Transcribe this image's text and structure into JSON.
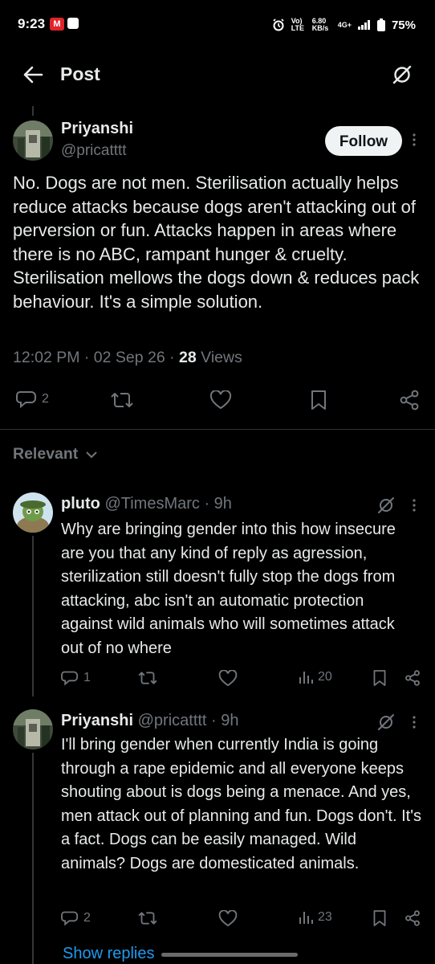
{
  "status_bar": {
    "time": "9:23",
    "badge": "M",
    "net_label": "Vo) LTE",
    "speed": "6.80 KB/s",
    "net_type": "4G+",
    "battery": "75%"
  },
  "header": {
    "title": "Post"
  },
  "post": {
    "name": "Priyanshi",
    "handle": "@pricatttt",
    "follow_label": "Follow",
    "text": "No. Dogs are not men. Sterilisation actually helps reduce attacks because dogs aren't attacking out of perversion or fun. Attacks happen in areas where there is no ABC, rampant hunger & cruelty. Sterilisation mellows the dogs down & reduces pack behaviour. It's a simple solution.",
    "time_date": "12:02 PM · 02 Sep 26 · ",
    "views_count": "28",
    "views_label": " Views",
    "reply_count": "2"
  },
  "relevant": {
    "label": "Relevant"
  },
  "replies": [
    {
      "name": "pluto",
      "handle_time": "@TimesMarc · 9h",
      "text": "Why are bringing gender into this how insecure are you that any kind of reply as agression, sterilization still doesn't fully stop the dogs from attacking, abc isn't an automatic protection against wild animals who will sometimes attack out of no where",
      "reply_count": "1",
      "views": "20"
    },
    {
      "name": "Priyanshi",
      "handle_time": "@pricatttt · 9h",
      "text": "I'll bring gender when currently India is going through a rape epidemic and all everyone keeps shouting about is dogs being a menace. And yes, men attack out of planning and fun. Dogs don't. It's a fact. Dogs can be easily managed. Wild animals? Dogs are domesticated animals.",
      "reply_count": "2",
      "views": "23"
    }
  ],
  "show_replies": "Show replies",
  "icons": {
    "back": "back-arrow-icon",
    "grok": "grok-icon",
    "reply": "reply-icon",
    "repost": "repost-icon",
    "like": "like-icon",
    "bookmark": "bookmark-icon",
    "share": "share-icon",
    "views": "views-icon",
    "more": "more-icon"
  },
  "colors": {
    "background": "#000000",
    "text": "#e7e9ea",
    "muted": "#71767b",
    "link": "#1d9bf0",
    "follow_bg": "#eff3f4"
  }
}
